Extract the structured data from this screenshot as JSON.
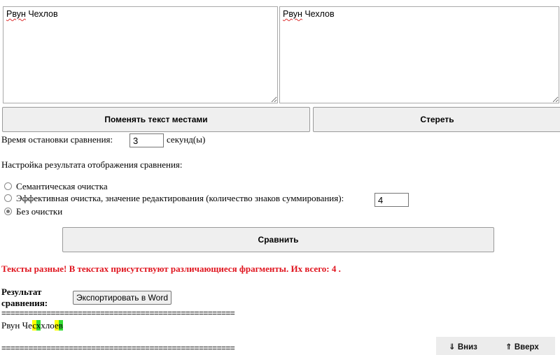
{
  "editor": {
    "left_text_word1": "Рвун",
    "left_text_word2": "Чехлов",
    "right_text_word1": "Рвун",
    "right_text_word2": "Чехлов"
  },
  "buttons": {
    "swap_label": "Поменять текст местами",
    "clear_label": "Стереть",
    "compare_label": "Сравнить",
    "export_label": "Экспортировать в Word"
  },
  "timeout": {
    "label": "Время остановки сравнения:",
    "value": "3",
    "unit": "секунд(ы)"
  },
  "display_settings": {
    "heading": "Настройка результата отображения сравнения:",
    "options": [
      {
        "label": "Семантическая очистка",
        "checked": false
      },
      {
        "label": "Эффективная очистка, значение редактирования (количество знаков суммирования):",
        "checked": false,
        "value": "4"
      },
      {
        "label": "Без очистки",
        "checked": true
      }
    ]
  },
  "result": {
    "message": "Тексты разные! В текстах присутствуют различающиеся фрагменты. Их всего: 4 .",
    "label": "Результат сравнения:",
    "separator": "====================================================",
    "diff_segments": [
      {
        "text": "Рвун Че",
        "type": "equal"
      },
      {
        "text": "с",
        "type": "deleted"
      },
      {
        "text": "х",
        "type": "inserted"
      },
      {
        "text": "хло",
        "type": "equal"
      },
      {
        "text": "е",
        "type": "deleted"
      },
      {
        "text": "в",
        "type": "inserted"
      }
    ]
  },
  "nav": {
    "down_icon": "arrow-down-icon",
    "down_label": "Вниз",
    "up_icon": "arrow-up-icon",
    "up_label": "Вверх"
  },
  "colors": {
    "error_text": "#e0141e",
    "deleted_highlight": "#ffff00",
    "inserted_highlight": "#33dd33"
  }
}
